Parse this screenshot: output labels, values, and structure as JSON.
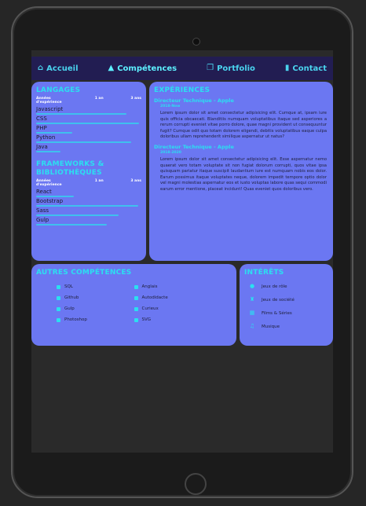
{
  "nav": {
    "items": [
      {
        "label": "Accueil",
        "icon": "home-icon",
        "glyph": "⌂"
      },
      {
        "label": "Compétences",
        "icon": "mountain-icon",
        "glyph": "▲"
      },
      {
        "label": "Portfolio",
        "icon": "images-icon",
        "glyph": "❐"
      },
      {
        "label": "Contact",
        "icon": "book-icon",
        "glyph": "▮"
      }
    ]
  },
  "languages": {
    "title": "Langages",
    "scale_label": "Années d'expérience",
    "scale_mid": "1 an",
    "scale_end": "3 ans",
    "skills": [
      {
        "name": "Javascript",
        "level": 0.86
      },
      {
        "name": "CSS",
        "level": 0.98
      },
      {
        "name": "PHP",
        "level": 0.34
      },
      {
        "name": "Python",
        "level": 0.9
      },
      {
        "name": "Java",
        "level": 0.23
      }
    ]
  },
  "frameworks": {
    "title": "Frameworks & Bibliothèques",
    "scale_label": "Années d'expérience",
    "scale_mid": "1 an",
    "scale_end": "3 ans",
    "skills": [
      {
        "name": "React",
        "level": 0.36
      },
      {
        "name": "Bootstrap",
        "level": 0.97
      },
      {
        "name": "Sass",
        "level": 0.78
      },
      {
        "name": "Gulp",
        "level": 0.67
      }
    ]
  },
  "experiences": {
    "title": "Expériences",
    "items": [
      {
        "title": "Directeur Technique - Apple",
        "date": "2018-Now",
        "text": "Lorem ipsum dolor sit amet consectetur adipisicing elit. Cumque at, ipsam iure quis officia obcaecati. Blanditiis numquam voluptatibus itaque sed asperiores a rerum corrupti eveniet vitae porro dolore, quae magni provident ut consequuntur fugit? Cumque odit quo totam dolorem eligendi, debitis voluptatibus eaque culpa doloribus ullam reprehenderit similique aspernatur ut natus?"
      },
      {
        "title": "Directeur Technique - Apple",
        "date": "2018-2020",
        "text": "Lorem ipsum dolor sit amet consectetur adipisicing elit. Esse aspernatur nemo quaerat vero totam voluptate sit non fugiat dolorum corrupti, quos vitae ipsa quisquam pariatur itaque suscipit laudantium iure est numquam nobis eos dolor. Earum possimus itaque voluptates neque, dolorem impedit tempore optio dolor vel magni molestias aspernatur eos et iusto voluptas labore quas sequi commodi earum error mentione, placeat incidunt! Quas eveniet quos doloribus vero."
      }
    ]
  },
  "other_skills": {
    "title": "Autres compétences",
    "items": [
      "SQL",
      "Anglais",
      "Github",
      "Autodidacte",
      "Gulp",
      "Curieux",
      "Photoshop",
      "SVG"
    ]
  },
  "interests": {
    "title": "Intérêts",
    "items": [
      {
        "label": "Jeux de rôle",
        "icon": "dice-icon",
        "glyph": "●"
      },
      {
        "label": "Jeux de société",
        "icon": "chess-icon",
        "glyph": "♜"
      },
      {
        "label": "Films & Séries",
        "icon": "film-icon",
        "glyph": "▦"
      },
      {
        "label": "Musique",
        "icon": "music-icon",
        "glyph": "♫"
      }
    ]
  }
}
